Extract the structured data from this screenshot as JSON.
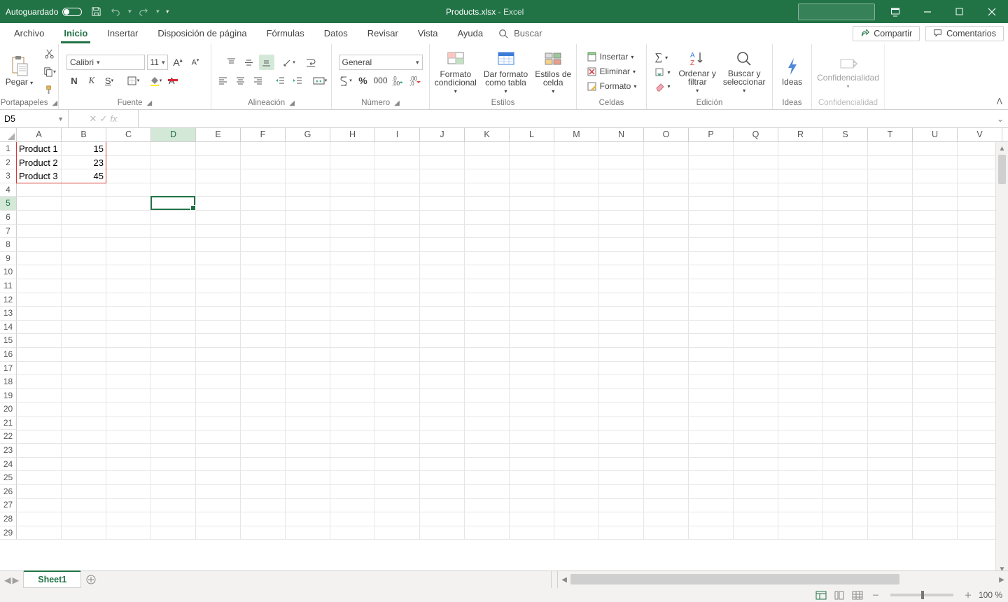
{
  "titlebar": {
    "autosave_label": "Autoguardado",
    "filename": "Products.xlsx",
    "app_suffix": " -  Excel"
  },
  "tabs": {
    "file": "Archivo",
    "home": "Inicio",
    "insert": "Insertar",
    "layout": "Disposición de página",
    "formulas": "Fórmulas",
    "data": "Datos",
    "review": "Revisar",
    "view": "Vista",
    "help": "Ayuda",
    "search": "Buscar",
    "share": "Compartir",
    "comments": "Comentarios"
  },
  "ribbon": {
    "clipboard": {
      "paste": "Pegar",
      "label": "Portapapeles"
    },
    "font": {
      "label": "Fuente",
      "name": "Calibri",
      "size": "11"
    },
    "alignment": {
      "label": "Alineación"
    },
    "number": {
      "label": "Número",
      "format": "General"
    },
    "styles": {
      "label": "Estilos",
      "cond": "Formato\ncondicional",
      "table": "Dar formato\ncomo tabla",
      "cell": "Estilos de\ncelda"
    },
    "cells": {
      "label": "Celdas",
      "insert": "Insertar",
      "delete": "Eliminar",
      "format": "Formato"
    },
    "editing": {
      "label": "Edición",
      "sort": "Ordenar y\nfiltrar",
      "find": "Buscar y\nseleccionar"
    },
    "ideas": {
      "label": "Ideas",
      "btn": "Ideas"
    },
    "sensitivity": {
      "label": "Confidencialidad",
      "btn": "Confidencialidad"
    }
  },
  "formula_bar": {
    "name_box": "D5",
    "formula": ""
  },
  "columns": [
    "A",
    "B",
    "C",
    "D",
    "E",
    "F",
    "G",
    "H",
    "I",
    "J",
    "K",
    "L",
    "M",
    "N",
    "O",
    "P",
    "Q",
    "R",
    "S",
    "T",
    "U",
    "V"
  ],
  "rows": [
    1,
    2,
    3,
    4,
    5,
    6,
    7,
    8,
    9,
    10,
    11,
    12,
    13,
    14,
    15,
    16,
    17,
    18,
    19,
    20,
    21,
    22,
    23,
    24,
    25,
    26,
    27,
    28,
    29
  ],
  "grid_data": {
    "A1": "Product 1",
    "B1": "15",
    "A2": "Product 2",
    "B2": "23",
    "A3": "Product 3",
    "B3": "45"
  },
  "active_cell": "D5",
  "active_col": "D",
  "active_row": 5,
  "red_range": "A1:B3",
  "sheets": {
    "active": "Sheet1"
  },
  "status": {
    "zoom": "100 %"
  }
}
